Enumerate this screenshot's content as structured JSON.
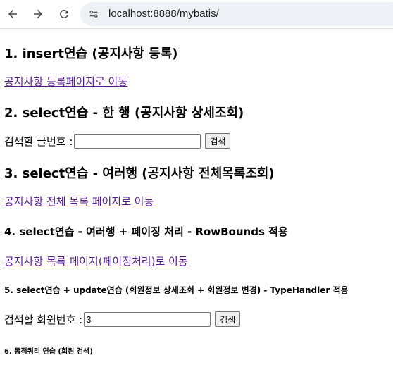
{
  "browser": {
    "url": "localhost:8888/mybatis/",
    "back_icon": "arrow-left-icon",
    "forward_icon": "arrow-right-icon",
    "reload_icon": "reload-icon",
    "site_info_icon": "site-info-icon"
  },
  "sections": {
    "s1": {
      "heading": "1. insert연습 (공지사항 등록)",
      "link": "공지사항 등록페이지로 이동"
    },
    "s2": {
      "heading": "2. select연습 - 한 행 (공지사항 상세조회)",
      "label": "검색할 글번호 :",
      "input_value": "",
      "button": "검색"
    },
    "s3": {
      "heading": "3. select연습 - 여러행 (공지사항 전체목록조회)",
      "link": "공지사항 전체 목록 페이지로 이동"
    },
    "s4": {
      "heading": "4. select연습 - 여러행 + 페이징 처리 - RowBounds 적용",
      "link": "공지사항 목록 페이지(페이징처리)로 이동"
    },
    "s5": {
      "heading": "5. select연습 + update연습 (회원정보 상세조회 + 회원정보 변경) - TypeHandler 적용",
      "label": "검색할 회원번호 :",
      "input_value": "3",
      "button": "검색"
    },
    "s6": {
      "heading": "6. 동적쿼리 연습 (회원 검색)"
    }
  },
  "colors": {
    "visited_link": "#551a8b",
    "omnibox_bg": "#eef1f6"
  }
}
